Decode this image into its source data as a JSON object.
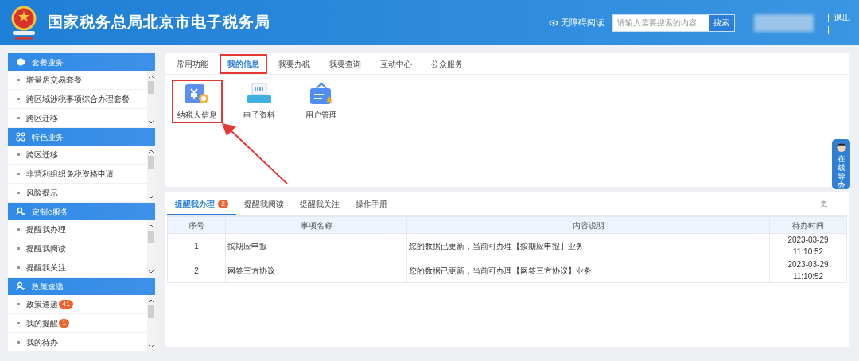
{
  "header": {
    "title": "国家税务总局北京市电子税务局",
    "accessibility": "无障碍阅读",
    "search": {
      "placeholder": "请输入需要搜索的内容",
      "button": "搜索"
    },
    "logout": "退出"
  },
  "sidebar": [
    {
      "title": "套餐业务",
      "items": [
        {
          "label": "增量房交易套餐"
        },
        {
          "label": "跨区域涉税事项综合办理套餐"
        },
        {
          "label": "跨区迁移"
        }
      ]
    },
    {
      "title": "特色业务",
      "items": [
        {
          "label": "跨区迁移"
        },
        {
          "label": "非营利组织免税资格申请"
        },
        {
          "label": "风险提示"
        }
      ]
    },
    {
      "title": "定制e服务",
      "items": [
        {
          "label": "提醒我办理"
        },
        {
          "label": "提醒我阅读"
        },
        {
          "label": "提醒我关注"
        }
      ]
    },
    {
      "title": "政策速递",
      "items": [
        {
          "label": "政策速递",
          "badge": "41"
        },
        {
          "label": "我的提醒",
          "badge": "1"
        },
        {
          "label": "我的待办"
        }
      ]
    }
  ],
  "main_tabs": [
    {
      "label": "常用功能",
      "selected": false,
      "highlighted": false
    },
    {
      "label": "我的信息",
      "selected": true,
      "highlighted": true
    },
    {
      "label": "我要办税",
      "selected": false,
      "highlighted": false
    },
    {
      "label": "我要查询",
      "selected": false,
      "highlighted": false
    },
    {
      "label": "互动中心",
      "selected": false,
      "highlighted": false
    },
    {
      "label": "公众服务",
      "selected": false,
      "highlighted": false
    }
  ],
  "functions": [
    {
      "label": "纳税人信息",
      "kind": "taxpayer",
      "highlighted": true
    },
    {
      "label": "电子资料",
      "kind": "printer",
      "highlighted": false
    },
    {
      "label": "用户管理",
      "kind": "user",
      "highlighted": false
    }
  ],
  "reminder_tabs": [
    {
      "label": "提醒我办理",
      "badge": "2",
      "selected": true
    },
    {
      "label": "提醒我阅读",
      "selected": false
    },
    {
      "label": "提醒我关注",
      "selected": false
    },
    {
      "label": "操作手册",
      "selected": false
    }
  ],
  "more_link": "更",
  "table": {
    "columns": [
      "序号",
      "事项名称",
      "内容说明",
      "待办时间"
    ],
    "rows": [
      [
        "1",
        "按期应申报",
        "您的数据已更新，当前可办理【按期应申报】业务",
        "2023-03-29 11:10:52"
      ],
      [
        "2",
        "网签三方协议",
        "您的数据已更新，当前可办理【网签三方协议】业务",
        "2023-03-29 11:10:52"
      ]
    ]
  },
  "float_button": "在线导办"
}
